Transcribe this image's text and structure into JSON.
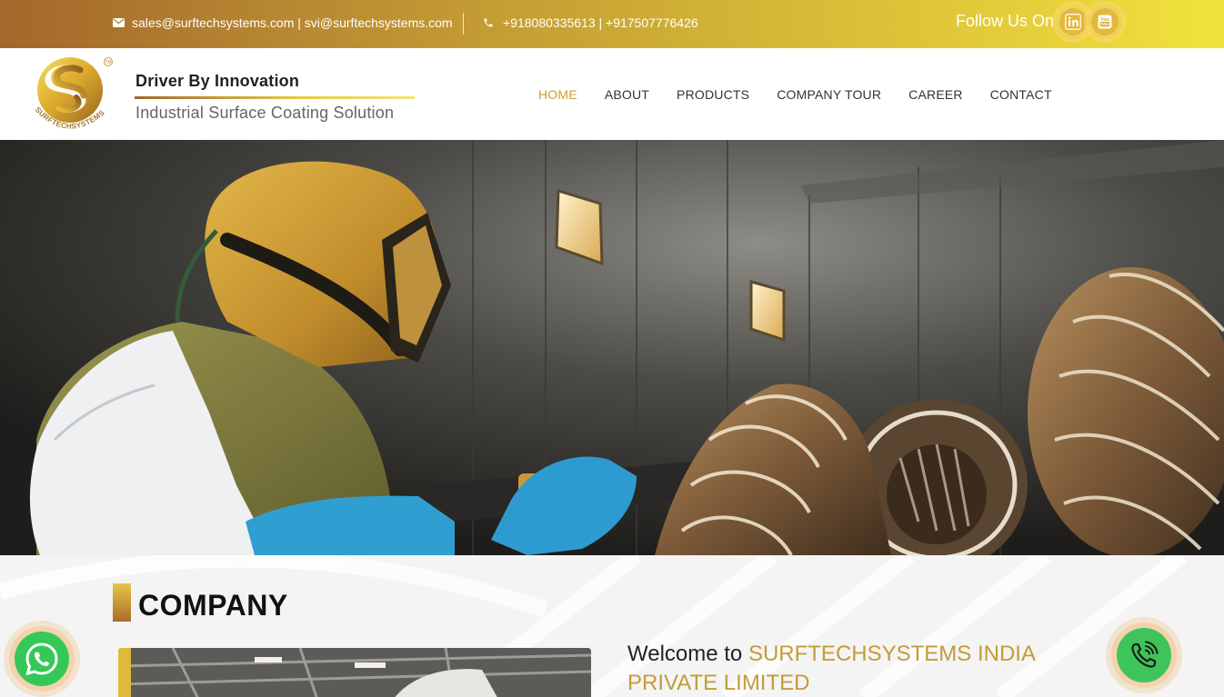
{
  "topbar": {
    "email_text": "sales@surftechsystems.com | svi@surftechsystems.com",
    "phone_text": "+918080335613 | +917507776426",
    "follow_text": "Follow Us On :",
    "social": [
      {
        "name": "linkedin-icon",
        "glyph": "in"
      },
      {
        "name": "youtube-icon",
        "glyph": "You"
      }
    ]
  },
  "header": {
    "logo_text": "SURFTECHSYSTEMS",
    "tagline_main": "Driver By Innovation",
    "tagline_sub": "Industrial Surface Coating Solution",
    "nav": [
      {
        "label": "HOME",
        "active": true
      },
      {
        "label": "ABOUT",
        "active": false
      },
      {
        "label": "PRODUCTS",
        "active": false
      },
      {
        "label": "COMPANY TOUR",
        "active": false
      },
      {
        "label": "CAREER",
        "active": false
      },
      {
        "label": "CONTACT",
        "active": false
      }
    ]
  },
  "company": {
    "title": "COMPANY",
    "welcome_prefix": "Welcome to ",
    "welcome_company": "SURFTECHSYSTEMS INDIA PRIVATE LIMITED"
  },
  "colors": {
    "gold": "#c9a035",
    "whatsapp_green": "#35c858",
    "call_green": "#3ec45a"
  }
}
